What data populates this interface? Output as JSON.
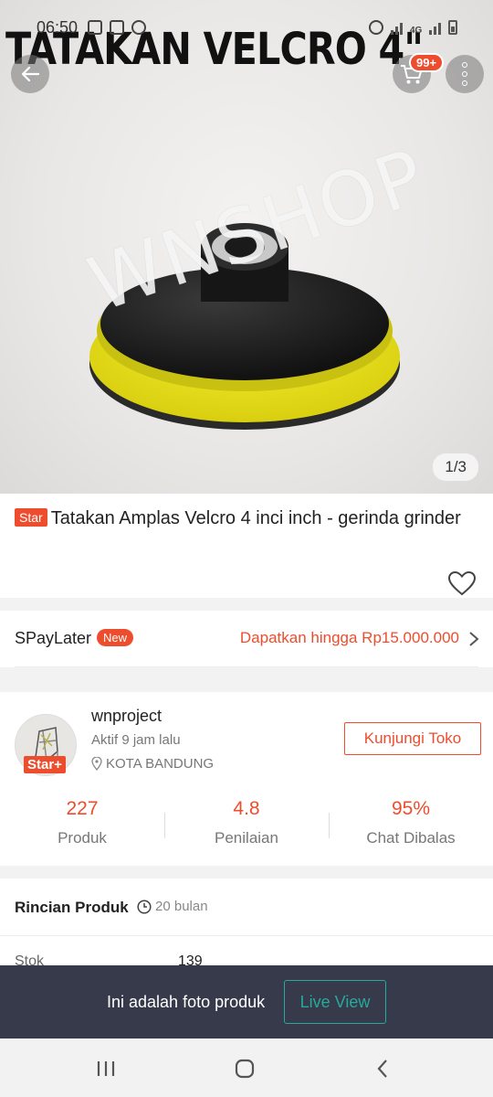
{
  "status_bar": {
    "time": "06:50",
    "network": "4G"
  },
  "hero": {
    "overlay_title": "TATAKAN VELCRO 4\"",
    "watermark": "WNSHOP",
    "pager": "1/3",
    "cart_badge": "99+"
  },
  "product": {
    "badge": "Star",
    "title": "Tatakan Amplas Velcro 4 inci inch - gerinda grinder"
  },
  "spaylater": {
    "label": "SPayLater",
    "badge": "New",
    "offer": "Dapatkan hingga Rp15.000.000"
  },
  "shop": {
    "name": "wnproject",
    "active": "Aktif 9 jam lalu",
    "location": "KOTA BANDUNG",
    "badge": "Star+",
    "visit_button": "Kunjungi Toko",
    "stats": [
      {
        "value": "227",
        "label": "Produk"
      },
      {
        "value": "4.8",
        "label": "Penilaian"
      },
      {
        "value": "95%",
        "label": "Chat Dibalas"
      }
    ]
  },
  "details": {
    "heading": "Rincian Produk",
    "age": "20 bulan",
    "stock_label": "Stok",
    "stock_value": "139"
  },
  "toast": {
    "message": "Ini adalah foto produk",
    "button": "Live View"
  },
  "colors": {
    "accent": "#ee4d2d",
    "teal": "#26aa99",
    "toast_bg": "#363a4a"
  }
}
